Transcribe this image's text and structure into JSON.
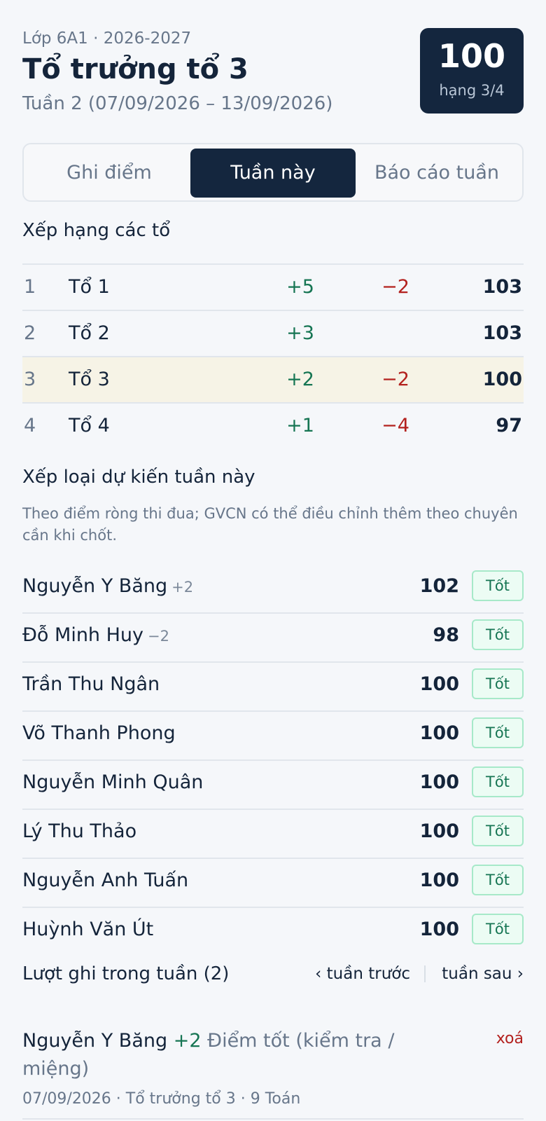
{
  "header": {
    "class_info": "Lớp 6A1 · 2026-2027",
    "title": "Tổ trưởng tổ 3",
    "week": "Tuần 2 (07/09/2026 – 13/09/2026)",
    "score": "100",
    "rank": "hạng 3/4"
  },
  "tabs": [
    {
      "label": "Ghi điểm",
      "active": false
    },
    {
      "label": "Tuần này",
      "active": true
    },
    {
      "label": "Báo cáo tuần",
      "active": false
    }
  ],
  "ranking": {
    "title": "Xếp hạng các tổ",
    "rows": [
      {
        "pos": "1",
        "name": "Tổ 1",
        "plus": "+5",
        "minus": "−2",
        "total": "103"
      },
      {
        "pos": "2",
        "name": "Tổ 2",
        "plus": "+3",
        "minus": "",
        "total": "103"
      },
      {
        "pos": "3",
        "name": "Tổ 3",
        "plus": "+2",
        "minus": "−2",
        "total": "100"
      },
      {
        "pos": "4",
        "name": "Tổ 4",
        "plus": "+1",
        "minus": "−4",
        "total": "97"
      }
    ]
  },
  "classification": {
    "title": "Xếp loại dự kiến tuần này",
    "note": "Theo điểm ròng thi đua; GVCN có thể điều chỉnh thêm theo chuyên cần khi chốt.",
    "students": [
      {
        "name": "Nguyễn Y Băng",
        "delta": "+2",
        "score": "102",
        "grade": "Tốt"
      },
      {
        "name": "Đỗ Minh Huy",
        "delta": "−2",
        "score": "98",
        "grade": "Tốt"
      },
      {
        "name": "Trần Thu Ngân",
        "delta": "",
        "score": "100",
        "grade": "Tốt"
      },
      {
        "name": "Võ Thanh Phong",
        "delta": "",
        "score": "100",
        "grade": "Tốt"
      },
      {
        "name": "Nguyễn Minh Quân",
        "delta": "",
        "score": "100",
        "grade": "Tốt"
      },
      {
        "name": "Lý Thu Thảo",
        "delta": "",
        "score": "100",
        "grade": "Tốt"
      },
      {
        "name": "Nguyễn Anh Tuấn",
        "delta": "",
        "score": "100",
        "grade": "Tốt"
      },
      {
        "name": "Huỳnh Văn Út",
        "delta": "",
        "score": "100",
        "grade": "Tốt"
      }
    ]
  },
  "log": {
    "title": "Lượt ghi trong tuần (2)",
    "prev": "‹ tuần trước",
    "next": "tuần sau ›",
    "entries": [
      {
        "student": "Nguyễn Y Băng",
        "points": "+2",
        "reason": "Điểm tốt (kiểm tra / miệng)",
        "meta": "07/09/2026 · Tổ trưởng tổ 3 · 9 Toán",
        "delete": "xoá"
      }
    ]
  },
  "colors": {
    "accent_dark": "#14263e",
    "positive": "#167553",
    "negative": "#b3211e",
    "highlight_row": "#f6f3e6",
    "badge_bg": "#ecfcf4"
  }
}
